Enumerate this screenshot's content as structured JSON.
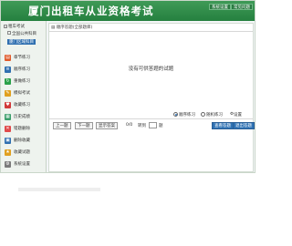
{
  "app": {
    "title": "厦门出租车从业资格考试"
  },
  "title_buttons": {
    "settings": "系统设置",
    "feedback": "常见问题"
  },
  "tree": {
    "root": "租车考试",
    "items": [
      {
        "label": "全国公共科目"
      },
      {
        "label": "厦门区域科目",
        "selected": true
      }
    ]
  },
  "menu": [
    {
      "label": "章节练习",
      "icon": "chapter-icon",
      "color": "#e05a2a"
    },
    {
      "label": "顺序练习",
      "icon": "sequence-icon",
      "color": "#2f6fb0"
    },
    {
      "label": "重做练习",
      "icon": "redo-icon",
      "color": "#2aa14a"
    },
    {
      "label": "模拟考试",
      "icon": "exam-icon",
      "color": "#e0a020"
    },
    {
      "label": "收藏练习",
      "icon": "favorite-icon",
      "color": "#d13a3a"
    },
    {
      "label": "历史成绩",
      "icon": "history-icon",
      "color": "#3a9e6a"
    },
    {
      "label": "错题删除",
      "icon": "delete-icon",
      "color": "#e04a4a"
    },
    {
      "label": "删除收藏",
      "icon": "remove-fav-icon",
      "color": "#2f6fb0"
    },
    {
      "label": "收藏试题",
      "icon": "star-icon",
      "color": "#e0a020"
    },
    {
      "label": "系统设置",
      "icon": "settings-icon",
      "color": "#7a7a7a"
    }
  ],
  "content": {
    "breadcrumb": "顺序答题(全部题库)",
    "empty_message": "没有可供答题的试题",
    "options": {
      "sequence": "顺序练习",
      "random": "随机练习",
      "settings": "设置"
    },
    "nav": {
      "prev": "上一题",
      "next": "下一题",
      "show_answer": "显示答案",
      "counter": "0/0",
      "jump_label": "转到",
      "jump_suffix": "题",
      "submit": "查看答题",
      "exit": "退出答题"
    }
  },
  "colors": {
    "titlebar": "#2e8b4a",
    "accent": "#2f72b4"
  }
}
